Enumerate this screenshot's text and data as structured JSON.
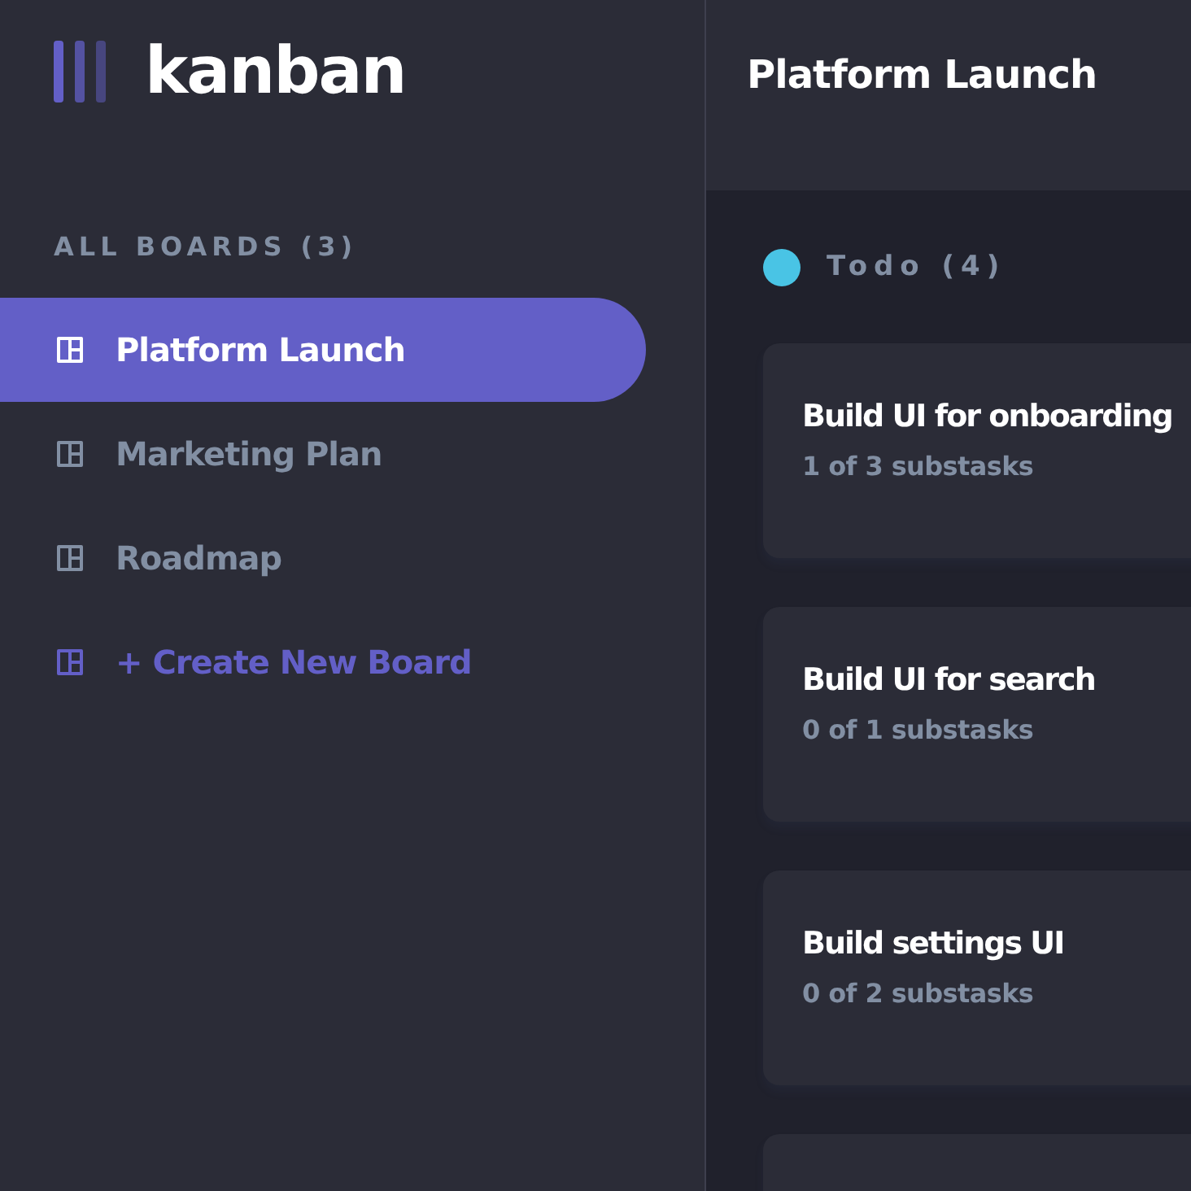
{
  "logo": {
    "text": "kanban"
  },
  "sidebar": {
    "heading": "ALL BOARDS (3)",
    "items": [
      {
        "kind": "board",
        "label": "Platform Launch",
        "selected": true
      },
      {
        "kind": "board",
        "label": "Marketing Plan",
        "selected": false
      },
      {
        "kind": "board",
        "label": "Roadmap",
        "selected": false
      },
      {
        "kind": "create",
        "label": "+ Create New Board",
        "selected": false
      }
    ]
  },
  "header": {
    "title": "Platform Launch"
  },
  "columns": [
    {
      "title": "Todo (4)",
      "color": "#49c4e5",
      "tasks": [
        {
          "kind": "card",
          "title": "Build UI for onboarding",
          "subtitle": "1 of 3 substasks"
        },
        {
          "kind": "card",
          "title": "Build UI for search",
          "subtitle": "0 of 1 substasks"
        },
        {
          "kind": "card",
          "title": "Build settings UI",
          "subtitle": "0 of 2 substasks"
        },
        {
          "kind": "clipped"
        }
      ]
    }
  ]
}
